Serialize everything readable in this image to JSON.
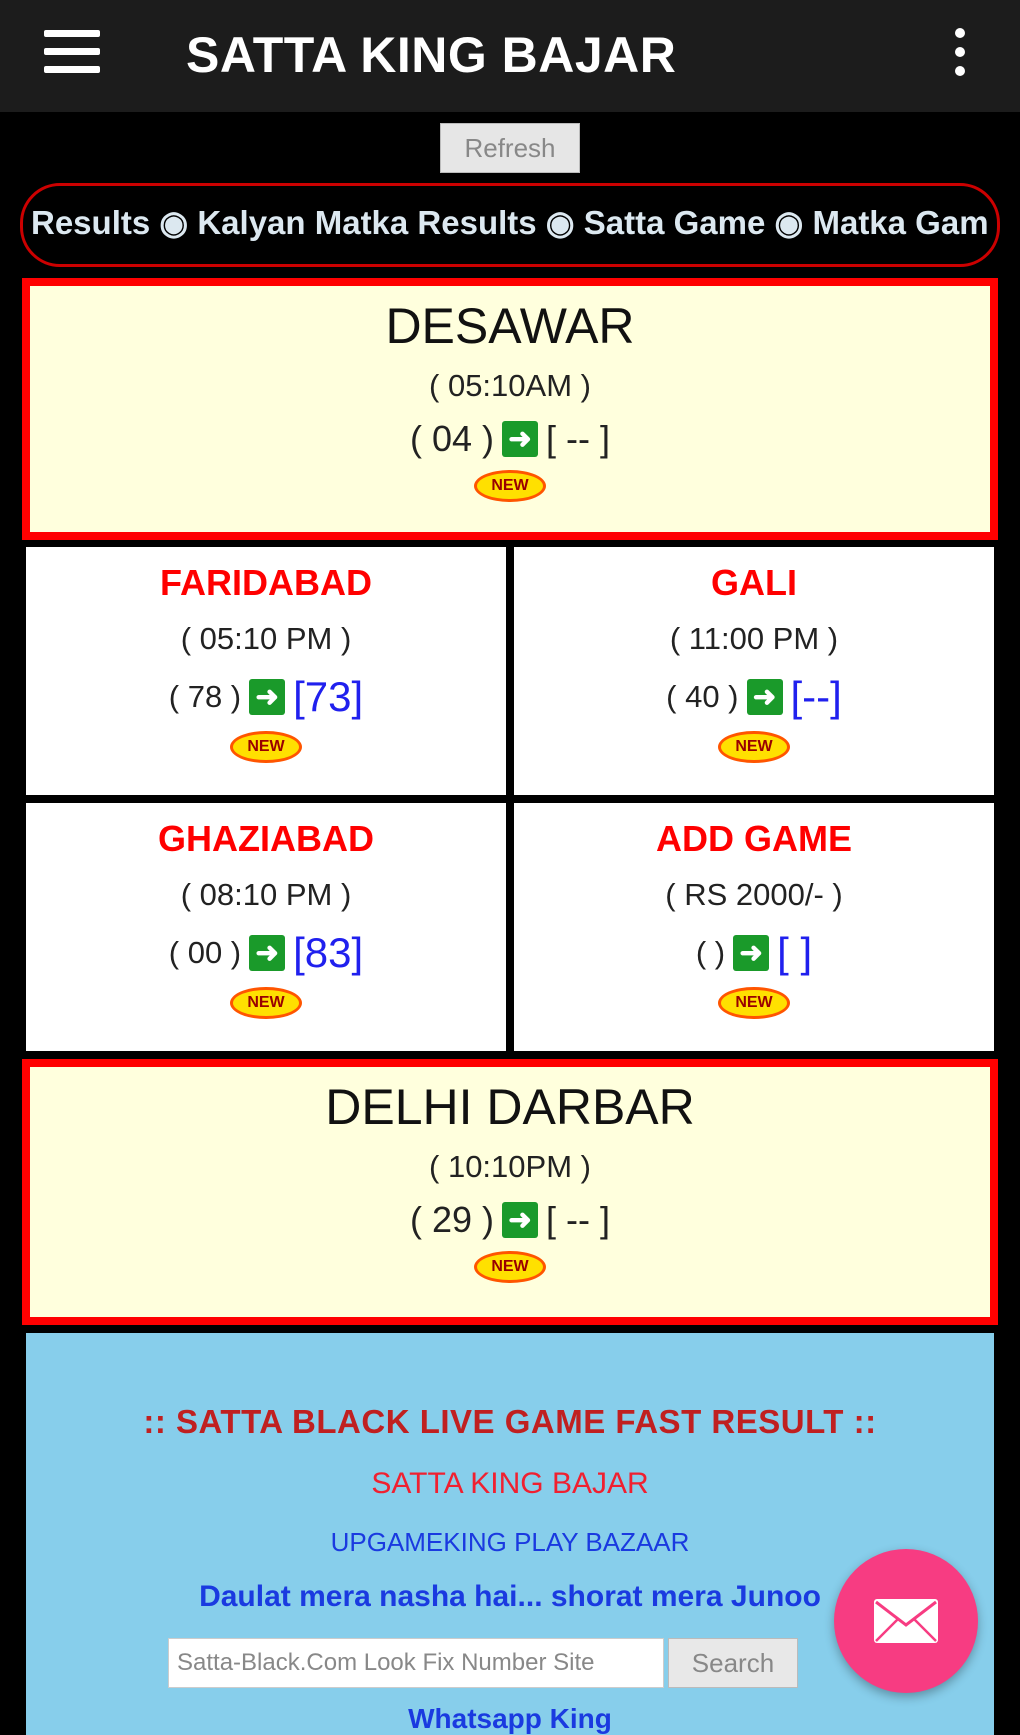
{
  "app": {
    "title": "SATTA KING BAJAR"
  },
  "refresh_label": "Refresh",
  "ticker": {
    "text": "Results ◉ Kalyan Matka Results ◉ Satta Game ◉ Matka Gam"
  },
  "games": {
    "desawar": {
      "name": "DESAWAR",
      "time": "( 05:10AM )",
      "prev": "( 04 )",
      "result": "[ -- ]",
      "badge": "NEW"
    },
    "faridabad": {
      "name": "FARIDABAD",
      "time": "( 05:10 PM )",
      "prev": "( 78 )",
      "result": "[73]",
      "badge": "NEW"
    },
    "gali": {
      "name": "GALI",
      "time": "( 11:00 PM )",
      "prev": "( 40 )",
      "result": "[--]",
      "badge": "NEW"
    },
    "ghaziabad": {
      "name": "GHAZIABAD",
      "time": "( 08:10 PM )",
      "prev": "( 00 )",
      "result": "[83]",
      "badge": "NEW"
    },
    "add_game": {
      "name": "ADD GAME",
      "time": "( RS 2000/- )",
      "prev": "( )",
      "result": "[ ]",
      "badge": "NEW"
    },
    "delhi_darbar": {
      "name": "DELHI DARBAR",
      "time": "( 10:10PM )",
      "prev": "( 29 )",
      "result": "[ -- ]",
      "badge": "NEW"
    }
  },
  "info": {
    "headline": ":: SATTA BLACK LIVE GAME FAST RESULT ::",
    "subtitle": "SATTA KING BAJAR",
    "link": "UPGAMEKING PLAY BAZAAR",
    "marquee": "Daulat mera nasha hai... shorat mera Junoo",
    "search_placeholder": "Satta-Black.Com Look Fix Number Site",
    "search_label": "Search",
    "footer": "Whatsapp King"
  },
  "icons": {
    "menu": "hamburger-icon",
    "more": "kebab-icon",
    "arrow": "arrow-right-icon",
    "fab": "mail-icon"
  },
  "colors": {
    "appbar": "#1c1c1c",
    "card_border": "#ff0000",
    "card_bg": "#ffffdd",
    "result_blue": "#2020ee",
    "name_red": "#ff0000",
    "info_bg": "#87ceeb",
    "fab": "#f73c82"
  }
}
